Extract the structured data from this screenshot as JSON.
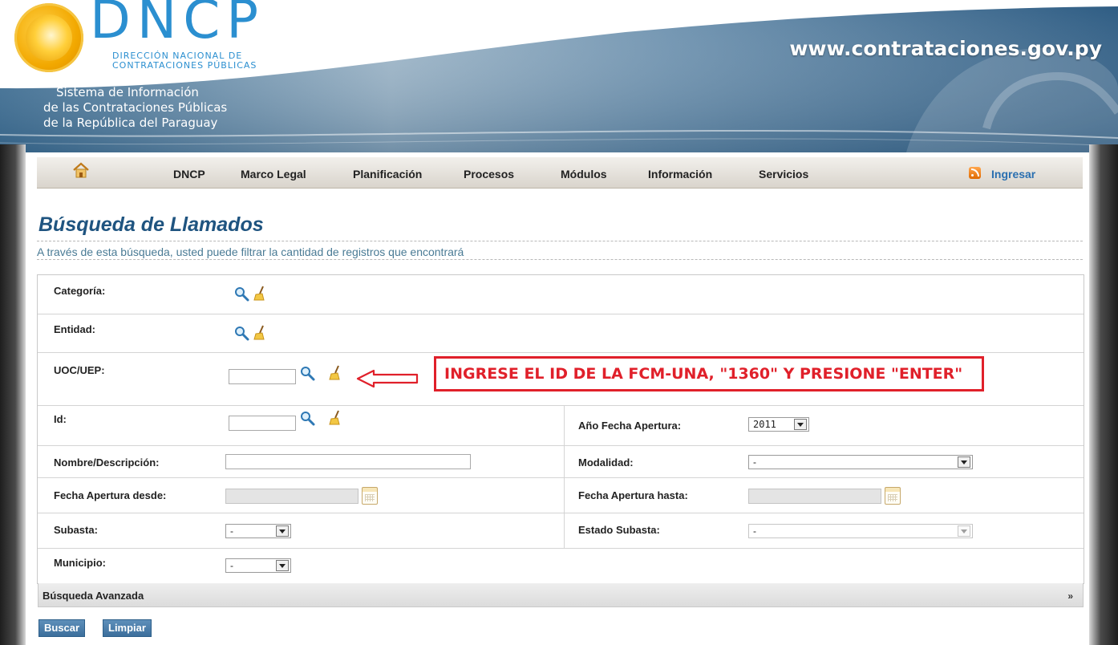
{
  "header": {
    "logo_title": "DNCP",
    "logo_subtitle_line1": "DIRECCIÓN NACIONAL DE",
    "logo_subtitle_line2": "CONTRATACIONES PÚBLICAS",
    "site_url": "www.contrataciones.gov.py",
    "system_line1": "Sistema de Información",
    "system_line2": "de las Contrataciones Públicas",
    "system_line3": "de la República del Paraguay"
  },
  "nav": {
    "home_icon": "home-icon",
    "items": [
      "DNCP",
      "Marco Legal",
      "Planificación",
      "Procesos",
      "Módulos",
      "Información",
      "Servicios"
    ],
    "rss_icon": "rss-icon",
    "login": "Ingresar"
  },
  "page": {
    "title": "Búsqueda de Llamados",
    "subtitle": "A través de esta búsqueda, usted puede filtrar la cantidad de registros que encontrará"
  },
  "form": {
    "categoria_label": "Categoría:",
    "entidad_label": "Entidad:",
    "uoc_label": "UOC/UEP:",
    "uoc_value": "",
    "id_label": "Id:",
    "id_value": "",
    "anio_label": "Año Fecha Apertura:",
    "anio_value": "2011",
    "nombre_label": "Nombre/Descripción:",
    "nombre_value": "",
    "modalidad_label": "Modalidad:",
    "modalidad_value": "-",
    "fecha_desde_label": "Fecha Apertura desde:",
    "fecha_desde_value": "",
    "fecha_hasta_label": "Fecha Apertura hasta:",
    "fecha_hasta_value": "",
    "subasta_label": "Subasta:",
    "subasta_value": "-",
    "estado_subasta_label": "Estado Subasta:",
    "estado_subasta_value": "-",
    "municipio_label": "Municipio:",
    "municipio_value": "-",
    "advanced_label": "Búsqueda Avanzada",
    "advanced_toggle": "»"
  },
  "annotation": {
    "text": "INGRESE EL ID DE LA FCM-UNA, \"1360\" Y PRESIONE \"ENTER\"",
    "color": "#e0202a"
  },
  "buttons": {
    "search": "Buscar",
    "clear": "Limpiar"
  },
  "colors": {
    "title": "#1f5480",
    "link": "#2a6fb0",
    "button": "#3c6f9c",
    "logo_blue": "#2b8fd0"
  }
}
